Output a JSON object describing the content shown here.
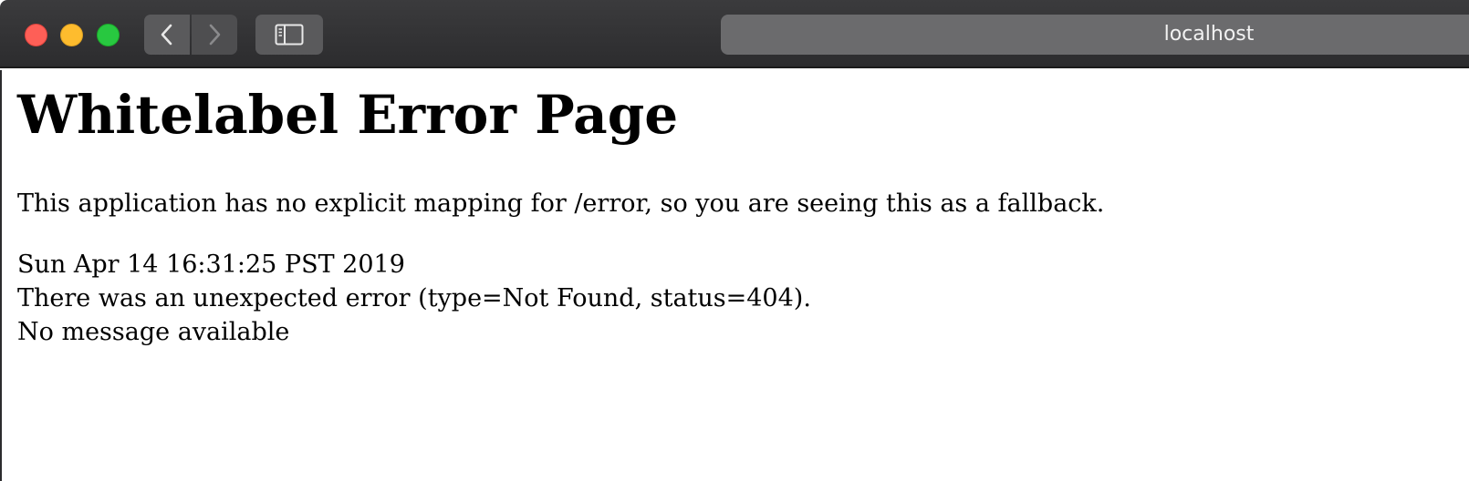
{
  "browser": {
    "address": "localhost",
    "controls": {
      "close_color": "#fe5f57",
      "minimize_color": "#febc2e",
      "maximize_color": "#28c840"
    },
    "icons": {
      "back": "chevron-left-icon",
      "forward": "chevron-right-icon",
      "sidebar": "sidebar-icon"
    }
  },
  "page": {
    "title": "Whitelabel Error Page",
    "explanation": "This application has no explicit mapping for /error, so you are seeing this as a fallback.",
    "timestamp": "Sun Apr 14 16:31:25 PST 2019",
    "error_line": "There was an unexpected error (type=Not Found, status=404).",
    "message": "No message available"
  }
}
